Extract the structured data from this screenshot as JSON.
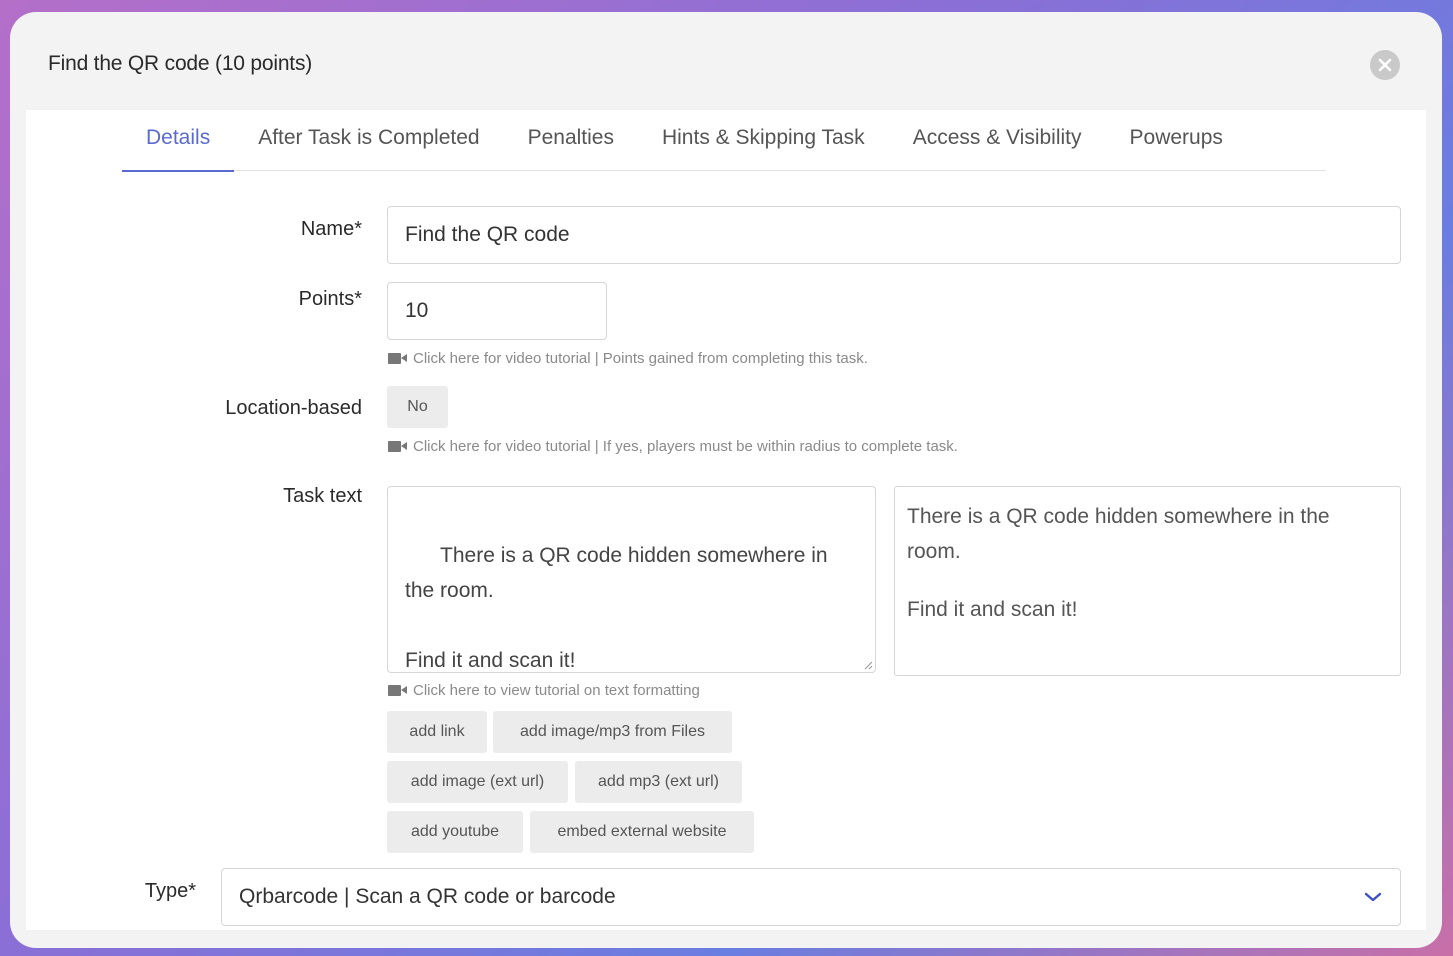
{
  "modal": {
    "title": "Find the QR code (10 points)",
    "close_icon": "close-circle-icon"
  },
  "tabs": [
    {
      "label": "Details",
      "active": true
    },
    {
      "label": "After Task is Completed",
      "active": false
    },
    {
      "label": "Penalties",
      "active": false
    },
    {
      "label": "Hints & Skipping Task",
      "active": false
    },
    {
      "label": "Access & Visibility",
      "active": false
    },
    {
      "label": "Powerups",
      "active": false
    }
  ],
  "form": {
    "name": {
      "label": "Name*",
      "value": "Find the QR code"
    },
    "points": {
      "label": "Points*",
      "value": "10",
      "help": "Click here for video tutorial | Points gained from completing this task."
    },
    "location": {
      "label": "Location-based",
      "value": "No",
      "help": "Click here for video tutorial | If yes, players must be within radius to complete task."
    },
    "task_text": {
      "label": "Task text",
      "value": "There is a QR code hidden somewhere in the room.\n\nFind it and scan it!",
      "preview_p1": "There is a QR code hidden somewhere in the room.",
      "preview_p2": "Find it and scan it!",
      "help": "Click here to view tutorial on text formatting",
      "buttons": [
        "add link",
        "add image/mp3 from Files",
        "add image (ext url)",
        "add mp3 (ext url)",
        "add youtube",
        "embed external website"
      ]
    },
    "type": {
      "label": "Type*",
      "value": "Qrbarcode | Scan a QR code or barcode"
    }
  },
  "colors": {
    "accent": "#5b6ad0",
    "modal_bg": "#f3f3f3",
    "button_bg": "#ececec"
  }
}
